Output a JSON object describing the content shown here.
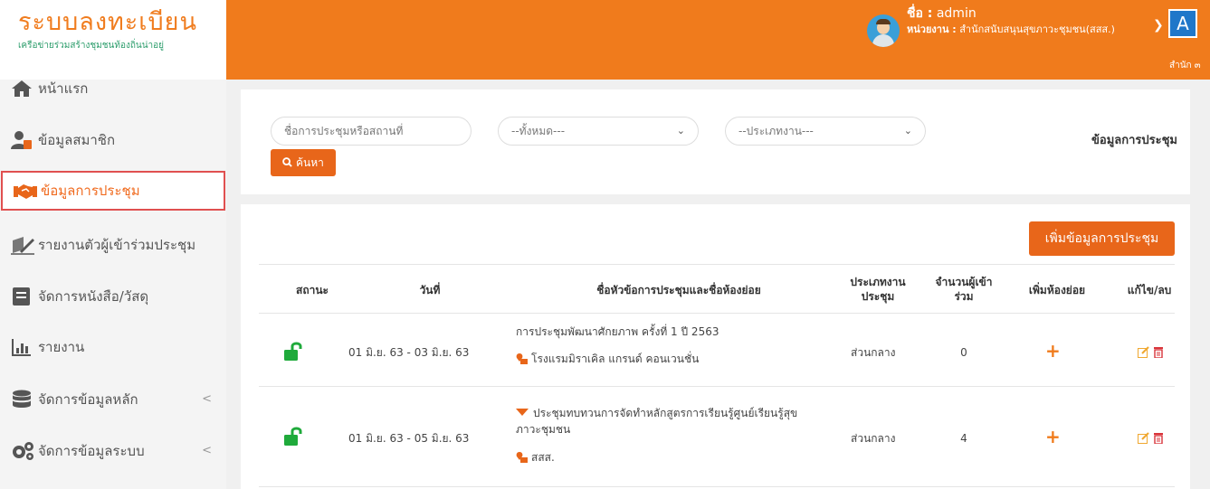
{
  "brand": {
    "title": "ระบบลงทะเบียน",
    "subtitle": "เครือข่ายร่วมสร้างชุมชนท้องถิ่นน่าอยู่"
  },
  "sidebar": {
    "items": [
      {
        "label": "หน้าแรก",
        "icon": "home-icon"
      },
      {
        "label": "ข้อมูลสมาชิก",
        "icon": "users-icon"
      },
      {
        "label": "ข้อมูลการประชุม",
        "icon": "handshake-icon",
        "active": true
      },
      {
        "label": "รายงานตัวผู้เข้าร่วมประชุม",
        "icon": "signature-icon"
      },
      {
        "label": "จัดการหนังสือ/วัสดุ",
        "icon": "book-icon"
      },
      {
        "label": "รายงาน",
        "icon": "bar-chart-icon"
      },
      {
        "label": "จัดการข้อมูลหลัก",
        "icon": "database-icon",
        "chevron": "<"
      },
      {
        "label": "จัดการข้อมูลระบบ",
        "icon": "gears-icon",
        "chevron": "<"
      }
    ]
  },
  "header": {
    "name_label": "ชื่อ :",
    "name_value": "admin",
    "unit_label": "หน่วยงาน :",
    "unit_value": "สำนักสนับสนุนสุขภาวะชุมชน(สสส.)",
    "org_badge": "A",
    "org_name": "สำนัก ๓"
  },
  "search": {
    "keyword_placeholder": "ชื่อการประชุมหรือสถานที่",
    "filter1_selected": "--ทั้งหมด---",
    "filter2_selected": "--ประเภทงาน---",
    "button_label": "ค้นหา",
    "card_title": "ข้อมูลการประชุม"
  },
  "list": {
    "add_button": "เพิ่มข้อมูลการประชุม",
    "columns": {
      "status": "สถานะ",
      "date": "วันที่",
      "topic": "ชื่อหัวข้อการประชุมและชื่อห้องย่อย",
      "type_l1": "ประเภทงาน",
      "type_l2": "ประชุม",
      "count_l1": "จำนวนผู้เข้า",
      "count_l2": "ร่วม",
      "add_room": "เพิ่มห้องย่อย",
      "edit": "แก้ไข/ลบ"
    },
    "rows": [
      {
        "status": "unlocked",
        "date": "01 มิ.ย. 63 - 03 มิ.ย. 63",
        "topic_l1": "การประชุมพัฒนาศักยภาพ ครั้งที่ 1 ปี 2563",
        "topic_l2": "",
        "location": "โรงแรมมิราเคิล แกรนด์ คอนเวนชั่น",
        "type": "ส่วนกลาง",
        "count": "0",
        "add_room": "+"
      },
      {
        "status": "unlocked",
        "date": "01 มิ.ย. 63 - 05 มิ.ย. 63",
        "topic_l1": "ประชุมทบทวนการจัดทำหลักสูตรการเรียนรู้ศูนย์เรียนรู้สุข",
        "topic_l2": "ภาวะชุมชน",
        "location": "สสส.",
        "type": "ส่วนกลาง",
        "count": "4",
        "add_room": "+"
      }
    ]
  },
  "colors": {
    "accent": "#f07b1c",
    "button": "#e8661a",
    "lock": "#1faa3b",
    "brand_green": "#2a9c6a",
    "badge_blue": "#1f77c9"
  }
}
